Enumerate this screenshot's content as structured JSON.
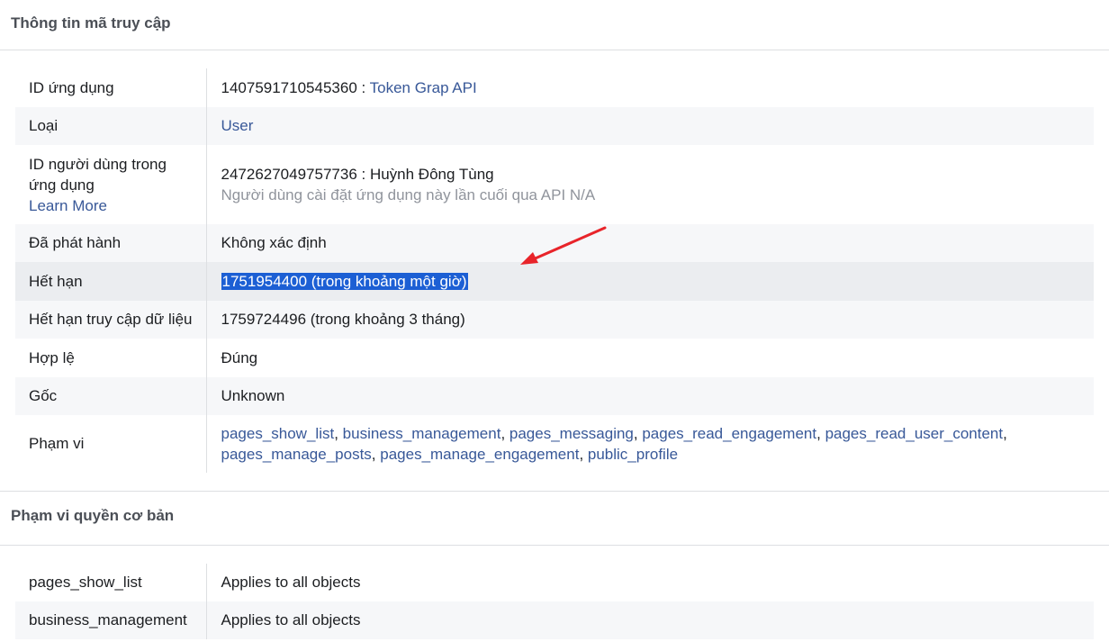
{
  "access_token_info": {
    "title": "Thông tin mã truy cập",
    "rows": {
      "app_id": {
        "label": "ID ứng dụng",
        "value": "1407591710545360 : ",
        "link": "Token Grap API"
      },
      "type": {
        "label": "Loại",
        "value": "User"
      },
      "user_id": {
        "label_line1": "ID người dùng trong",
        "label_line2": "ứng dụng",
        "learn_more": "Learn More",
        "value": "2472627049757736 : Huỳnh Đông Tùng",
        "sub": "Người dùng cài đặt ứng dụng này lần cuối qua API N/A"
      },
      "issued": {
        "label": "Đã phát hành",
        "value": "Không xác định"
      },
      "expires": {
        "label": "Hết hạn",
        "value": "1751954400 (trong khoảng một giờ)"
      },
      "data_access_expires": {
        "label": "Hết hạn truy cập dữ liệu",
        "value": "1759724496 (trong khoảng 3 tháng)"
      },
      "valid": {
        "label": "Hợp lệ",
        "value": "Đúng"
      },
      "origin": {
        "label": "Gốc",
        "value": "Unknown"
      },
      "scopes": {
        "label": "Phạm vi",
        "items": [
          "pages_show_list",
          "business_management",
          "pages_messaging",
          "pages_read_engagement",
          "pages_read_user_content",
          "pages_manage_posts",
          "pages_manage_engagement",
          "public_profile"
        ]
      }
    }
  },
  "basic_scopes": {
    "title": "Phạm vi quyền cơ bản",
    "rows": [
      {
        "scope": "pages_show_list",
        "target": "Applies to all objects"
      },
      {
        "scope": "business_management",
        "target": "Applies to all objects"
      }
    ]
  },
  "annotation": {
    "arrow_color": "#e8242a"
  }
}
